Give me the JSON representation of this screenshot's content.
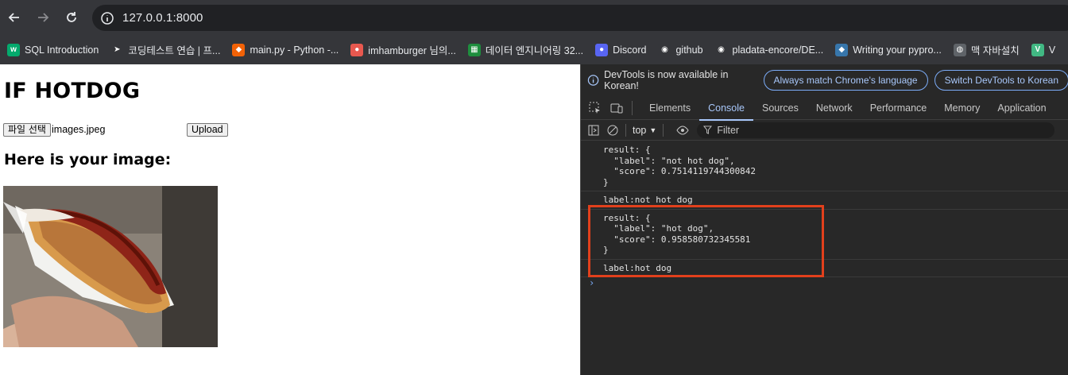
{
  "browser": {
    "url": "127.0.0.1:8000",
    "bookmarks": [
      {
        "label": "SQL Introduction",
        "icon": "w3schools-icon",
        "color": "#04aa6d",
        "glyph": "w"
      },
      {
        "label": "코딩테스트 연습 | 프...",
        "icon": "programmers-icon",
        "color": "#35363a",
        "glyph": "➤"
      },
      {
        "label": "main.py - Python -...",
        "icon": "replit-icon",
        "color": "#f26207",
        "glyph": "⬥"
      },
      {
        "label": "imhamburger 님의...",
        "icon": "velog-icon",
        "color": "#e8584f",
        "glyph": "●"
      },
      {
        "label": "데이터 엔지니어링 32...",
        "icon": "sheets-icon",
        "color": "#1e8e3e",
        "glyph": "▦"
      },
      {
        "label": "Discord",
        "icon": "discord-icon",
        "color": "#5865f2",
        "glyph": "●"
      },
      {
        "label": "github",
        "icon": "github-icon",
        "color": "#35363a",
        "glyph": "◉"
      },
      {
        "label": "pladata-encore/DE...",
        "icon": "github-icon",
        "color": "#35363a",
        "glyph": "◉"
      },
      {
        "label": "Writing your pypro...",
        "icon": "python-icon",
        "color": "#3776ab",
        "glyph": "◆"
      },
      {
        "label": "맥 자바설치",
        "icon": "globe-icon",
        "color": "#5f6368",
        "glyph": "◍"
      },
      {
        "label": "V",
        "icon": "vue-icon",
        "color": "#41b883",
        "glyph": "V"
      }
    ]
  },
  "page": {
    "title": "IF HOTDOG",
    "file_button_label": "파일 선택",
    "file_name": "images.jpeg",
    "upload_button_label": "Upload",
    "subtitle": "Here is your image:"
  },
  "devtools": {
    "banner_message": "DevTools is now available in Korean!",
    "banner_button_1": "Always match Chrome's language",
    "banner_button_2": "Switch DevTools to Korean",
    "tabs": [
      "Elements",
      "Console",
      "Sources",
      "Network",
      "Performance",
      "Memory",
      "Application"
    ],
    "active_tab": "Console",
    "context": "top",
    "filter_placeholder": "Filter",
    "console_messages": [
      "result: {\n  \"label\": \"not hot dog\",\n  \"score\": 0.7514119744300842\n}",
      "label:not hot dog",
      "result: {\n  \"label\": \"hot dog\",\n  \"score\": 0.958580732345581\n}",
      "label:hot dog"
    ],
    "prompt_symbol": "›",
    "highlight_color": "#e2401c"
  }
}
